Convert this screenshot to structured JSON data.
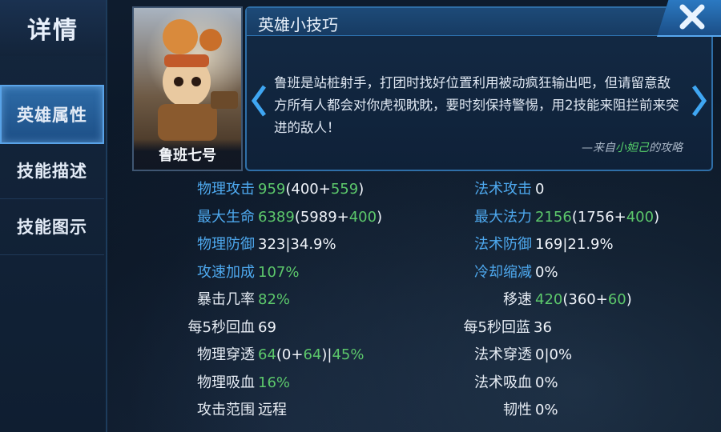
{
  "sidebar": {
    "title": "详情",
    "items": [
      {
        "label": "英雄属性",
        "active": true
      },
      {
        "label": "技能描述",
        "active": false
      },
      {
        "label": "技能图示",
        "active": false
      }
    ]
  },
  "hero": {
    "name": "鲁班七号"
  },
  "tips": {
    "title": "英雄小技巧",
    "text": "鲁班是站桩射手，打团时找好位置利用被动疯狂输出吧，但请留意敌方所有人都会对你虎视眈眈，要时刻保持警惕，用2技能来阻拦前来突进的敌人！",
    "source_prefix": "—来自",
    "source_author": "小妲己",
    "source_suffix": "的攻略"
  },
  "stats": {
    "left": [
      {
        "label": "物理攻击",
        "parts": [
          {
            "t": "959",
            "c": "green"
          },
          {
            "t": "(400+",
            "c": "white"
          },
          {
            "t": "559",
            "c": "green"
          },
          {
            "t": ")",
            "c": "white"
          }
        ]
      },
      {
        "label": "最大生命",
        "parts": [
          {
            "t": "6389",
            "c": "green"
          },
          {
            "t": "(5989+",
            "c": "white"
          },
          {
            "t": "400",
            "c": "green"
          },
          {
            "t": ")",
            "c": "white"
          }
        ]
      },
      {
        "label": "物理防御",
        "parts": [
          {
            "t": "323|34.9%",
            "c": "white"
          }
        ]
      },
      {
        "label": "攻速加成",
        "parts": [
          {
            "t": "107%",
            "c": "green"
          }
        ]
      },
      {
        "label": "暴击几率",
        "parts": [
          {
            "t": "82%",
            "c": "green"
          }
        ]
      },
      {
        "label": "每5秒回血",
        "parts": [
          {
            "t": "69",
            "c": "white"
          }
        ]
      },
      {
        "label": "物理穿透",
        "parts": [
          {
            "t": "64",
            "c": "green"
          },
          {
            "t": "(0+",
            "c": "white"
          },
          {
            "t": "64",
            "c": "green"
          },
          {
            "t": ")|",
            "c": "white"
          },
          {
            "t": "45%",
            "c": "green"
          }
        ]
      },
      {
        "label": "物理吸血",
        "parts": [
          {
            "t": "16%",
            "c": "green"
          }
        ]
      },
      {
        "label": "攻击范围",
        "parts": [
          {
            "t": "远程",
            "c": "white"
          }
        ]
      }
    ],
    "right": [
      {
        "label": "法术攻击",
        "parts": [
          {
            "t": "0",
            "c": "white"
          }
        ]
      },
      {
        "label": "最大法力",
        "parts": [
          {
            "t": "2156",
            "c": "green"
          },
          {
            "t": "(1756+",
            "c": "white"
          },
          {
            "t": "400",
            "c": "green"
          },
          {
            "t": ")",
            "c": "white"
          }
        ]
      },
      {
        "label": "法术防御",
        "parts": [
          {
            "t": "169|21.9%",
            "c": "white"
          }
        ]
      },
      {
        "label": "冷却缩减",
        "parts": [
          {
            "t": "0%",
            "c": "white"
          }
        ]
      },
      {
        "label": "移速",
        "parts": [
          {
            "t": "420",
            "c": "green"
          },
          {
            "t": "(360+",
            "c": "white"
          },
          {
            "t": "60",
            "c": "green"
          },
          {
            "t": ")",
            "c": "white"
          }
        ]
      },
      {
        "label": "每5秒回蓝",
        "parts": [
          {
            "t": "36",
            "c": "white"
          }
        ]
      },
      {
        "label": "法术穿透",
        "parts": [
          {
            "t": "0|0%",
            "c": "white"
          }
        ]
      },
      {
        "label": "法术吸血",
        "parts": [
          {
            "t": "0%",
            "c": "white"
          }
        ]
      },
      {
        "label": "韧性",
        "parts": [
          {
            "t": "0%",
            "c": "white"
          }
        ]
      }
    ]
  },
  "colors": {
    "accent_blue": "#4ea9ef",
    "value_green": "#5cc86b",
    "panel_border": "#2f6fa8"
  },
  "icons": [
    "arrow-left-icon",
    "arrow-right-icon",
    "close-icon"
  ]
}
